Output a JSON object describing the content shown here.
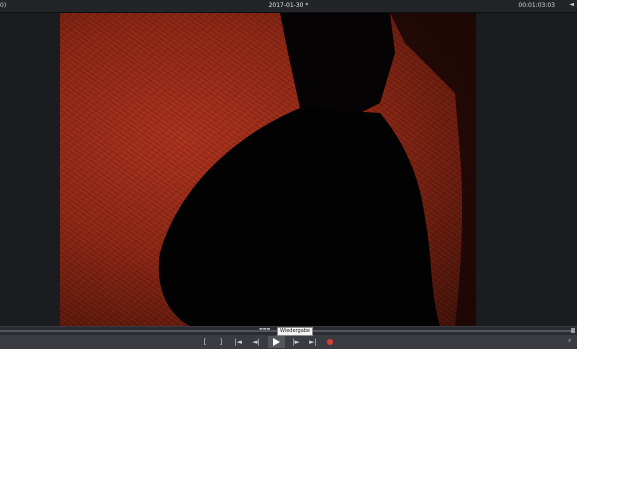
{
  "window": {
    "title": "2017-01-30 *",
    "left_glyph": "0)",
    "timecode": "00:01:03:03",
    "right_glyph": "◄"
  },
  "controls": {
    "mark_in": "[",
    "mark_out": "]",
    "go_to_start": "|◄",
    "step_back": "◄|",
    "step_forward": "|►",
    "go_to_end": "►|",
    "right_glyph": "⚡"
  },
  "tooltip": {
    "text": "Wiedergabe"
  },
  "colors": {
    "record": "#e23b3b",
    "background": "#1b1c20"
  },
  "icons": {
    "play": "play-icon",
    "record": "record-icon"
  }
}
